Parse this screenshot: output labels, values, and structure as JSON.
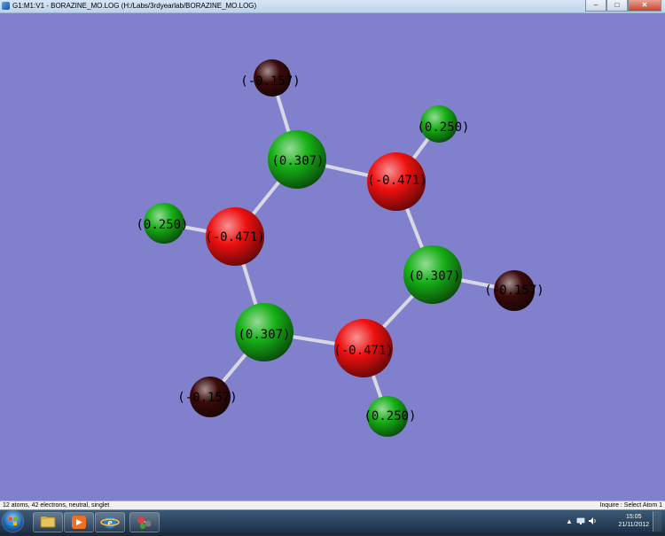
{
  "window": {
    "title": "G1:M1:V1 - BORAZINE_MO.LOG (H:/Labs/3rdyearlab/BORAZINE_MO.LOG)",
    "minimize_label": "–",
    "maximize_label": "□",
    "close_label": "✕"
  },
  "molecule": {
    "atoms": [
      {
        "element": "H",
        "charge": "(-0.157)",
        "color": "#3a0a0a"
      },
      {
        "element": "B",
        "charge": "(0.307)",
        "color": "#16b016"
      },
      {
        "element": "H",
        "charge": "(0.250)",
        "color": "#16b016"
      },
      {
        "element": "N",
        "charge": "(-0.471)",
        "color": "#ee1010"
      },
      {
        "element": "H",
        "charge": "(0.250)",
        "color": "#16b016"
      },
      {
        "element": "N",
        "charge": "(-0.471)",
        "color": "#ee1010"
      },
      {
        "element": "B",
        "charge": "(0.307)",
        "color": "#16b016"
      },
      {
        "element": "H",
        "charge": "(-0.157)",
        "color": "#3a0a0a"
      },
      {
        "element": "B",
        "charge": "(0.307)",
        "color": "#16b016"
      },
      {
        "element": "N",
        "charge": "(-0.471)",
        "color": "#ee1010"
      },
      {
        "element": "H",
        "charge": "(-0.157)",
        "color": "#3a0a0a"
      },
      {
        "element": "H",
        "charge": "(0.250)",
        "color": "#16b016"
      }
    ],
    "background": "#8080cc"
  },
  "status": {
    "left": "12 atoms, 42 electrons, neutral, singlet",
    "right": "Inquire : Select Atom 1"
  },
  "taskbar": {
    "start_label": "Start",
    "buttons": [
      "windows-explorer",
      "media-player",
      "internet-explorer",
      "gaussview"
    ],
    "tray_arrow": "▲",
    "clock_time": "15:05",
    "clock_date": "21/11/2012"
  }
}
